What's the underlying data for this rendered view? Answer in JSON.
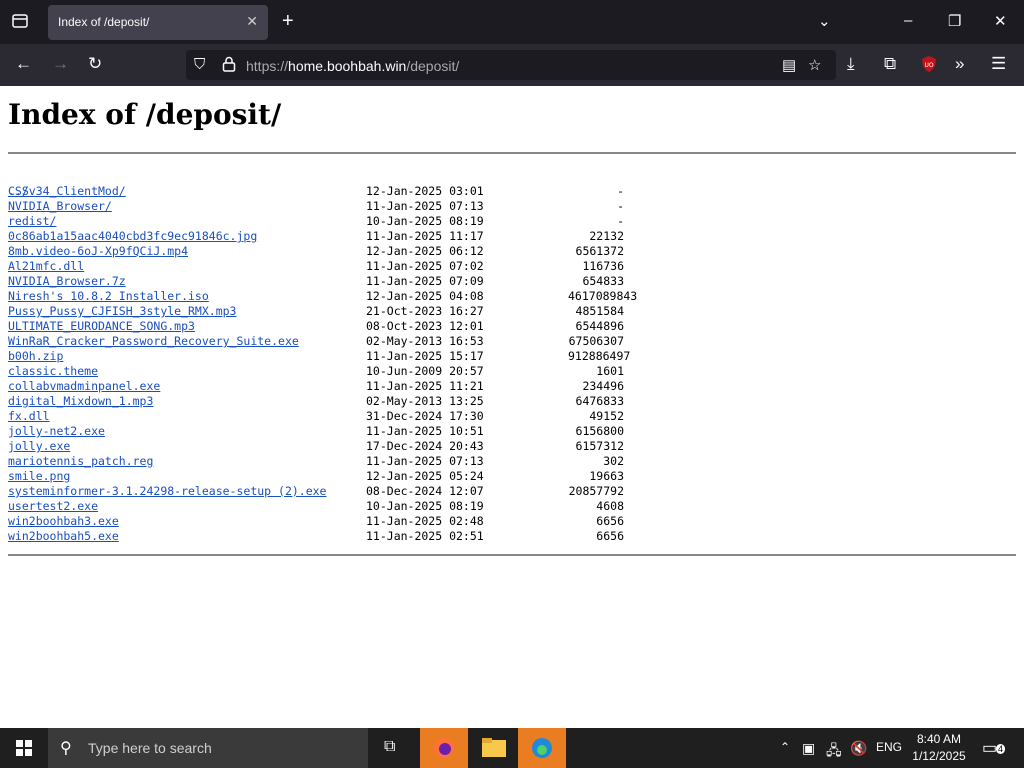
{
  "browser": {
    "tab_title": "Index of /deposit/",
    "url_prefix": "https://",
    "url_host": "home.boohbah.win",
    "url_path": "/deposit/"
  },
  "page": {
    "heading": "Index of /deposit/",
    "parent_link": "../",
    "entries": [
      {
        "name": "CSSv34_ClientMod/",
        "date": "12-Jan-2025 03:01",
        "size": "-"
      },
      {
        "name": "NVIDIA_Browser/",
        "date": "11-Jan-2025 07:13",
        "size": "-"
      },
      {
        "name": "redist/",
        "date": "10-Jan-2025 08:19",
        "size": "-"
      },
      {
        "name": "0c86ab1a15aac4040cbd3fc9ec91846c.jpg",
        "date": "11-Jan-2025 11:17",
        "size": "22132"
      },
      {
        "name": "8mb.video-6oJ-Xp9fQCiJ.mp4",
        "date": "12-Jan-2025 06:12",
        "size": "6561372"
      },
      {
        "name": "Al21mfc.dll",
        "date": "11-Jan-2025 07:02",
        "size": "116736"
      },
      {
        "name": "NVIDIA_Browser.7z",
        "date": "11-Jan-2025 07:09",
        "size": "654833"
      },
      {
        "name": "Niresh's 10.8.2 Installer.iso",
        "date": "12-Jan-2025 04:08",
        "size": "4617089843"
      },
      {
        "name": "Pussy_Pussy_CJFISH_3style_RMX.mp3",
        "date": "21-Oct-2023 16:27",
        "size": "4851584"
      },
      {
        "name": "ULTIMATE_EURODANCE_SONG.mp3",
        "date": "08-Oct-2023 12:01",
        "size": "6544896"
      },
      {
        "name": "WinRaR_Cracker_Password_Recovery_Suite.exe",
        "date": "02-May-2013 16:53",
        "size": "67506307"
      },
      {
        "name": "b00h.zip",
        "date": "11-Jan-2025 15:17",
        "size": "912886497"
      },
      {
        "name": "classic.theme",
        "date": "10-Jun-2009 20:57",
        "size": "1601"
      },
      {
        "name": "collabvmadminpanel.exe",
        "date": "11-Jan-2025 11:21",
        "size": "234496"
      },
      {
        "name": "digital_Mixdown_1.mp3",
        "date": "02-May-2013 13:25",
        "size": "6476833"
      },
      {
        "name": "fx.dll",
        "date": "31-Dec-2024 17:30",
        "size": "49152"
      },
      {
        "name": "jolly-net2.exe",
        "date": "11-Jan-2025 10:51",
        "size": "6156800"
      },
      {
        "name": "jolly.exe",
        "date": "17-Dec-2024 20:43",
        "size": "6157312"
      },
      {
        "name": "mariotennis_patch.reg",
        "date": "11-Jan-2025 07:13",
        "size": "302"
      },
      {
        "name": "smile.png",
        "date": "12-Jan-2025 05:24",
        "size": "19663"
      },
      {
        "name": "systeminformer-3.1.24298-release-setup (2).exe",
        "date": "08-Dec-2024 12:07",
        "size": "20857792"
      },
      {
        "name": "usertest2.exe",
        "date": "10-Jan-2025 08:19",
        "size": "4608"
      },
      {
        "name": "win2boohbah3.exe",
        "date": "11-Jan-2025 02:48",
        "size": "6656"
      },
      {
        "name": "win2boohbah5.exe",
        "date": "11-Jan-2025 02:51",
        "size": "6656"
      }
    ]
  },
  "taskbar": {
    "search_placeholder": "Type here to search",
    "language": "ENG",
    "time": "8:40 AM",
    "date": "1/12/2025",
    "notification_count": "4"
  },
  "colors": {
    "link": "#1a4fbf",
    "tab_bar": "#1c1b22",
    "toolbar": "#2b2a33",
    "active_taskbar_item": "#ea7d22"
  }
}
